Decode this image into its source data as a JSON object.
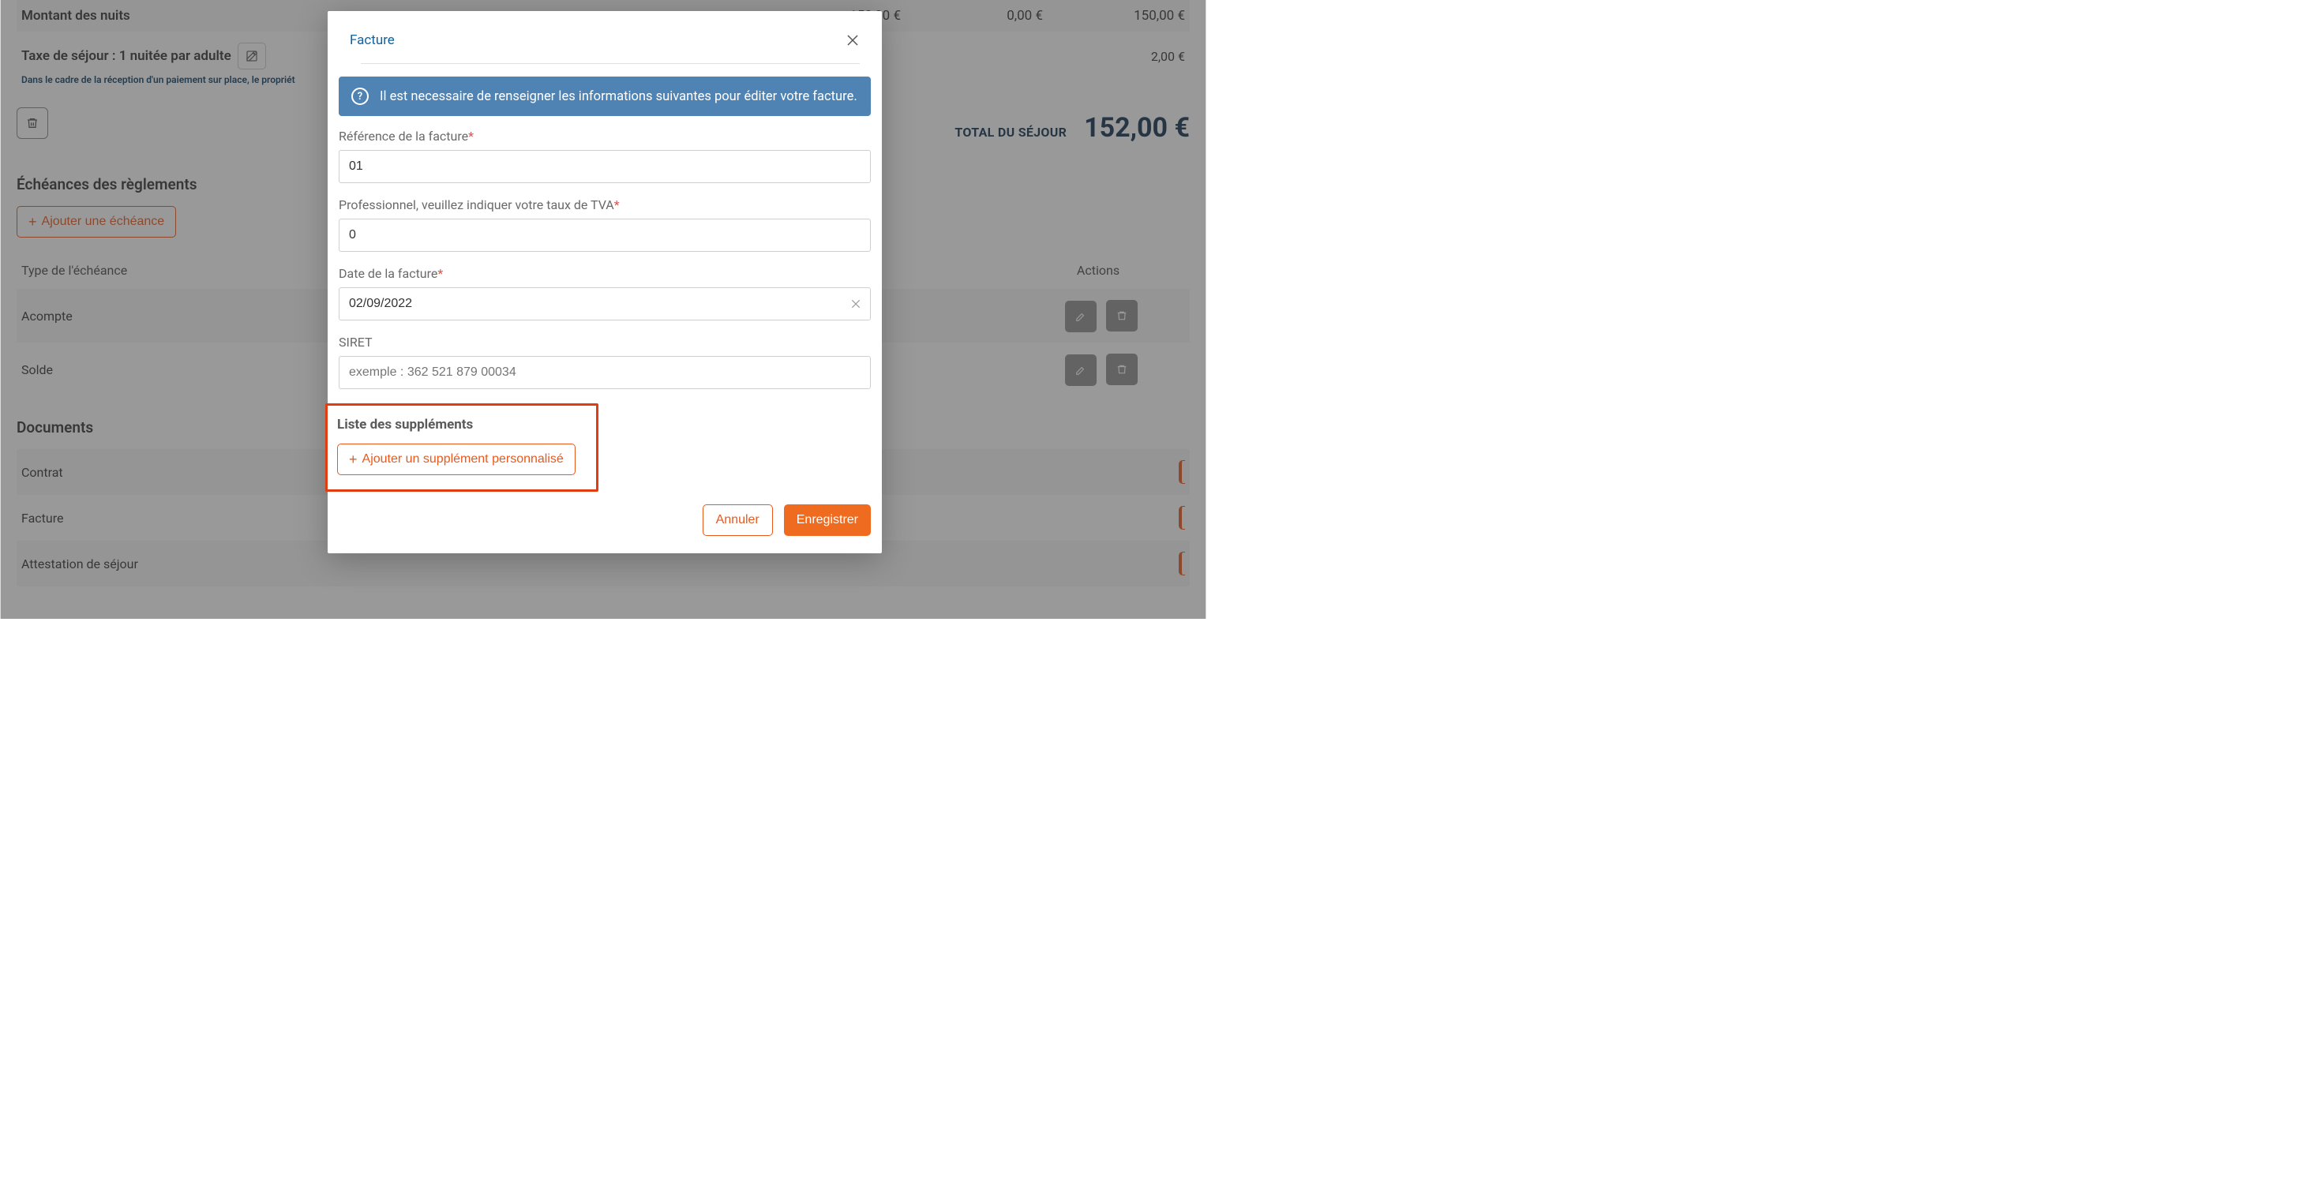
{
  "bg": {
    "nights": {
      "label": "Montant des nuits",
      "a": "150,00 €",
      "b": "0,00 €",
      "c": "150,00 €"
    },
    "taxe": {
      "label": "Taxe de séjour : 1 nuitée par adulte",
      "value": "2,00 €",
      "note": "Dans le cadre de la réception d'un paiement sur place, le propriét"
    },
    "total": {
      "label": "TOTAL DU SÉJOUR",
      "value": "152,00 €"
    },
    "schedules": {
      "title": "Échéances des règlements",
      "add": "Ajouter une échéance",
      "col_type": "Type de l'échéance",
      "col_actions": "Actions",
      "rows": [
        {
          "label": "Acompte"
        },
        {
          "label": "Solde"
        }
      ]
    },
    "documents": {
      "title": "Documents",
      "rows": [
        {
          "label": "Contrat"
        },
        {
          "label": "Facture"
        },
        {
          "label": "Attestation de séjour"
        }
      ]
    }
  },
  "modal": {
    "title": "Facture",
    "alert": "Il est necessaire de renseigner les informations suivantes pour éditer votre facture.",
    "fields": {
      "ref": {
        "label": "Référence de la facture",
        "value": "01"
      },
      "tva": {
        "label": "Professionnel, veuillez indiquer votre taux de TVA",
        "value": "0"
      },
      "date": {
        "label": "Date de la facture",
        "value": "02/09/2022"
      },
      "siret": {
        "label": "SIRET",
        "placeholder": "exemple : 362 521 879 00034"
      }
    },
    "supp": {
      "title": "Liste des suppléments",
      "add": "Ajouter un supplément personnalisé"
    },
    "cancel": "Annuler",
    "save": "Enregistrer"
  }
}
